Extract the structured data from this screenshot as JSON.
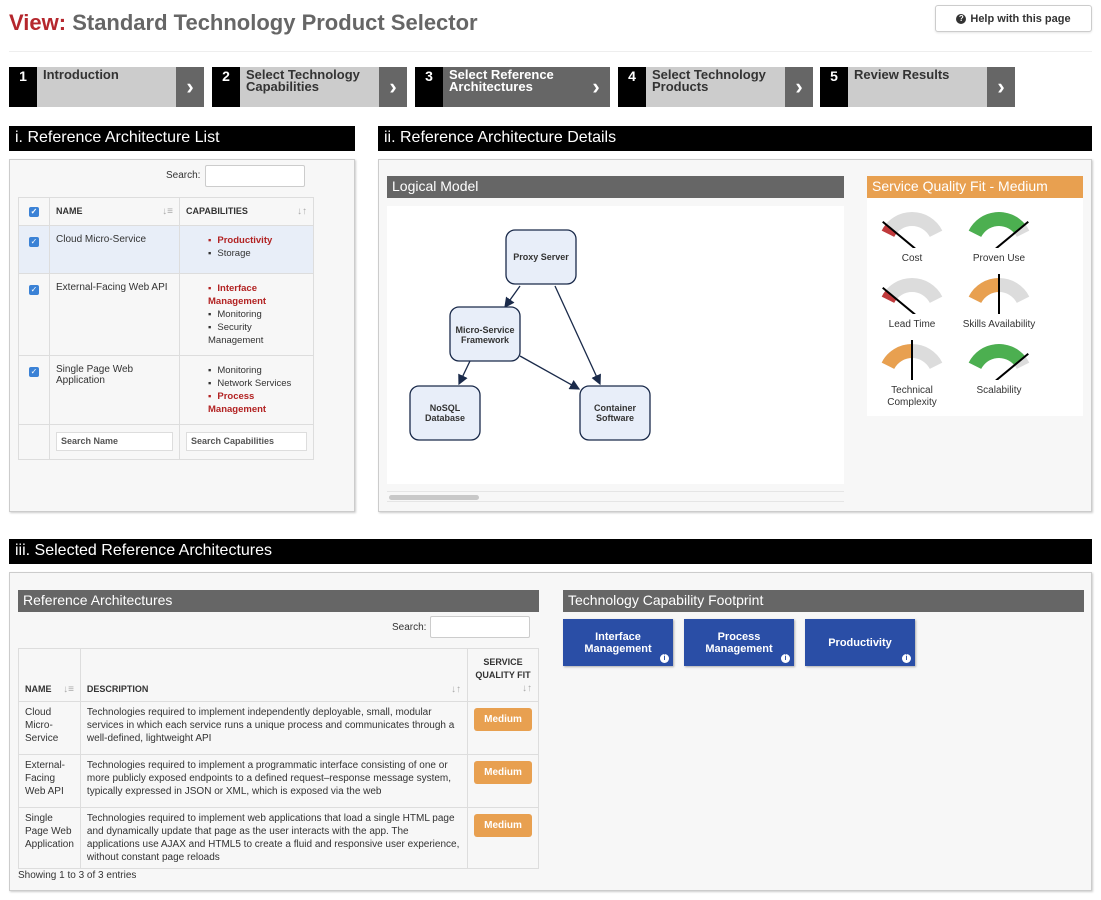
{
  "header": {
    "view_label": "View:",
    "title": "Standard Technology Product Selector",
    "help_button": "Help with this page"
  },
  "steps": [
    {
      "num": "1",
      "label": "Introduction",
      "active": false
    },
    {
      "num": "2",
      "label": "Select Technology Capabilities",
      "active": false
    },
    {
      "num": "3",
      "label": "Select Reference Architectures",
      "active": true
    },
    {
      "num": "4",
      "label": "Select Technology Products",
      "active": false
    },
    {
      "num": "5",
      "label": "Review Results",
      "active": false
    }
  ],
  "section1": {
    "title": "i. Reference Architecture List",
    "search_label": "Search:",
    "search_value": "",
    "columns": [
      "NAME",
      "CAPABILITIES"
    ],
    "rows": [
      {
        "name": "Cloud Micro-Service",
        "checked": true,
        "capabilities": [
          {
            "label": "Productivity",
            "highlight": true
          },
          {
            "label": "Storage",
            "highlight": false
          }
        ]
      },
      {
        "name": "External-Facing Web API",
        "checked": true,
        "capabilities": [
          {
            "label": "Interface Management",
            "highlight": true
          },
          {
            "label": "Monitoring",
            "highlight": false
          },
          {
            "label": "Security Management",
            "highlight": false
          }
        ]
      },
      {
        "name": "Single Page Web Application",
        "checked": true,
        "capabilities": [
          {
            "label": "Monitoring",
            "highlight": false
          },
          {
            "label": "Network Services",
            "highlight": false
          },
          {
            "label": "Process Management",
            "highlight": true
          }
        ]
      }
    ],
    "filter_name_placeholder": "Search Name",
    "filter_caps_placeholder": "Search Capabilities"
  },
  "section2": {
    "title": "ii. Reference Architecture Details",
    "logical_model_title": "Logical Model",
    "nodes": {
      "proxy": "Proxy Server",
      "msf_1": "Micro-Service",
      "msf_2": "Framework",
      "nosql_1": "NoSQL",
      "nosql_2": "Database",
      "cont_1": "Container",
      "cont_2": "Software"
    },
    "edges": [
      [
        "Proxy Server",
        "Micro-Service Framework"
      ],
      [
        "Proxy Server",
        "Container Software"
      ],
      [
        "Micro-Service Framework",
        "NoSQL Database"
      ],
      [
        "Micro-Service Framework",
        "Container Software"
      ]
    ],
    "sqf_title": "Service Quality Fit - Medium",
    "gauges": [
      {
        "label": "Cost",
        "value": 0.1,
        "color": "#c0393b"
      },
      {
        "label": "Proven Use",
        "value": 0.9,
        "color": "#4caf50"
      },
      {
        "label": "Lead Time",
        "value": 0.1,
        "color": "#c0393b"
      },
      {
        "label": "Skills Availability",
        "value": 0.5,
        "color": "#e8a050"
      },
      {
        "label": "Technical Complexity",
        "value": 0.5,
        "color": "#e8a050"
      },
      {
        "label": "Scalability",
        "value": 0.9,
        "color": "#4caf50"
      }
    ]
  },
  "section3": {
    "title": "iii. Selected Reference Architectures",
    "ra_title": "Reference Architectures",
    "search_label": "Search:",
    "columns": [
      "NAME",
      "DESCRIPTION",
      "SERVICE QUALITY FIT"
    ],
    "rows": [
      {
        "name": "Cloud Micro-Service",
        "description": "Technologies required to implement independently deployable, small, modular services in which each service runs a unique process and communicates through a well-defined, lightweight API",
        "fit": "Medium"
      },
      {
        "name": "External-Facing Web API",
        "description": "Technologies required to implement a programmatic interface consisting of one or more publicly exposed endpoints to a defined request–response message system, typically expressed in JSON or XML, which is exposed via the web",
        "fit": "Medium"
      },
      {
        "name": "Single Page Web Application",
        "description": "Technologies required to implement web applications that load a single HTML page and dynamically update that page as the user interacts with the app. The applications use AJAX and HTML5 to create a fluid and responsive user experience, without constant page reloads",
        "fit": "Medium"
      }
    ],
    "footer": "Showing 1 to 3 of 3 entries",
    "footprint_title": "Technology Capability Footprint",
    "footprint": [
      "Interface Management",
      "Process Management",
      "Productivity"
    ]
  },
  "colors": {
    "brand_red": "#b5272d",
    "orange": "#e8a050",
    "blue": "#2a4ea6"
  }
}
